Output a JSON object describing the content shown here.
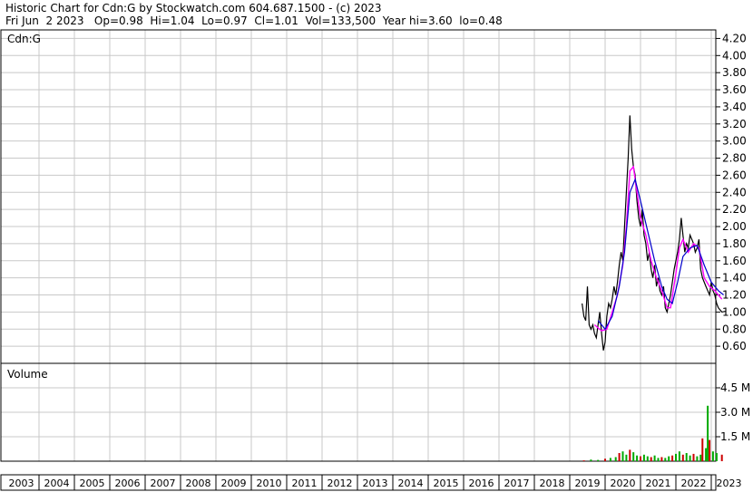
{
  "header": {
    "line1": "Historic Chart for Cdn:G by Stockwatch.com 604.687.1500 - (c) 2023",
    "line2": "Fri Jun  2 2023   Op=0.98  Hi=1.04  Lo=0.97  Cl=1.01  Vol=133,500  Year hi=3.60  lo=0.48"
  },
  "colors": {
    "grid": "#c8c8c8",
    "price": "#000000",
    "ma_short": "#ff00ff",
    "ma_long": "#0000cc",
    "vol_up": "#00aa00",
    "vol_down": "#cc0000"
  },
  "chart_data": [
    {
      "type": "line",
      "title": "Cdn:G",
      "x_axis": "year",
      "ylim": [
        0.4,
        4.3
      ],
      "y_ticks": [
        "4.20",
        "4.00",
        "3.80",
        "3.60",
        "3.40",
        "3.20",
        "3.00",
        "2.80",
        "2.60",
        "2.40",
        "2.20",
        "2.00",
        "1.80",
        "1.60",
        "1.40",
        "1.20",
        "1.00",
        "0.80",
        "0.60"
      ],
      "grid": true,
      "series": [
        {
          "style": "price-bars",
          "points": [
            [
              2019.35,
              1.1
            ],
            [
              2019.4,
              0.95
            ],
            [
              2019.45,
              0.9
            ],
            [
              2019.5,
              1.3
            ],
            [
              2019.55,
              0.85
            ],
            [
              2019.6,
              0.8
            ],
            [
              2019.65,
              0.85
            ],
            [
              2019.7,
              0.75
            ],
            [
              2019.75,
              0.7
            ],
            [
              2019.8,
              0.85
            ],
            [
              2019.85,
              1.0
            ],
            [
              2019.9,
              0.75
            ],
            [
              2019.95,
              0.55
            ],
            [
              2020.0,
              0.65
            ],
            [
              2020.05,
              0.95
            ],
            [
              2020.1,
              1.1
            ],
            [
              2020.15,
              1.05
            ],
            [
              2020.2,
              1.15
            ],
            [
              2020.25,
              1.3
            ],
            [
              2020.3,
              1.2
            ],
            [
              2020.35,
              1.35
            ],
            [
              2020.4,
              1.55
            ],
            [
              2020.45,
              1.7
            ],
            [
              2020.5,
              1.6
            ],
            [
              2020.55,
              2.0
            ],
            [
              2020.6,
              2.4
            ],
            [
              2020.65,
              2.8
            ],
            [
              2020.7,
              3.3
            ],
            [
              2020.75,
              2.9
            ],
            [
              2020.8,
              2.7
            ],
            [
              2020.85,
              2.6
            ],
            [
              2020.9,
              2.3
            ],
            [
              2020.95,
              2.1
            ],
            [
              2021.0,
              2.0
            ],
            [
              2021.05,
              2.2
            ],
            [
              2021.1,
              1.9
            ],
            [
              2021.15,
              1.8
            ],
            [
              2021.2,
              1.6
            ],
            [
              2021.25,
              1.7
            ],
            [
              2021.3,
              1.5
            ],
            [
              2021.35,
              1.4
            ],
            [
              2021.4,
              1.55
            ],
            [
              2021.45,
              1.3
            ],
            [
              2021.5,
              1.4
            ],
            [
              2021.55,
              1.25
            ],
            [
              2021.6,
              1.2
            ],
            [
              2021.65,
              1.3
            ],
            [
              2021.7,
              1.05
            ],
            [
              2021.75,
              1.0
            ],
            [
              2021.8,
              1.1
            ],
            [
              2021.85,
              1.2
            ],
            [
              2021.9,
              1.35
            ],
            [
              2021.95,
              1.5
            ],
            [
              2022.0,
              1.6
            ],
            [
              2022.05,
              1.7
            ],
            [
              2022.1,
              1.85
            ],
            [
              2022.15,
              2.1
            ],
            [
              2022.2,
              1.9
            ],
            [
              2022.25,
              1.7
            ],
            [
              2022.3,
              1.8
            ],
            [
              2022.35,
              1.75
            ],
            [
              2022.4,
              1.9
            ],
            [
              2022.45,
              1.85
            ],
            [
              2022.5,
              1.8
            ],
            [
              2022.55,
              1.7
            ],
            [
              2022.6,
              1.75
            ],
            [
              2022.65,
              1.85
            ],
            [
              2022.7,
              1.5
            ],
            [
              2022.75,
              1.4
            ],
            [
              2022.8,
              1.35
            ],
            [
              2022.85,
              1.3
            ],
            [
              2022.9,
              1.25
            ],
            [
              2022.95,
              1.2
            ],
            [
              2023.0,
              1.35
            ],
            [
              2023.05,
              1.25
            ],
            [
              2023.1,
              1.2
            ],
            [
              2023.15,
              1.1
            ],
            [
              2023.2,
              1.05
            ],
            [
              2023.3,
              1.0
            ],
            [
              2023.42,
              1.01
            ]
          ]
        },
        {
          "style": "moving-average-short",
          "points": [
            [
              2019.7,
              0.85
            ],
            [
              2019.9,
              0.78
            ],
            [
              2020.05,
              0.8
            ],
            [
              2020.2,
              1.0
            ],
            [
              2020.35,
              1.2
            ],
            [
              2020.5,
              1.55
            ],
            [
              2020.6,
              2.0
            ],
            [
              2020.7,
              2.65
            ],
            [
              2020.8,
              2.7
            ],
            [
              2020.9,
              2.4
            ],
            [
              2021.0,
              2.1
            ],
            [
              2021.15,
              1.9
            ],
            [
              2021.3,
              1.6
            ],
            [
              2021.45,
              1.4
            ],
            [
              2021.6,
              1.25
            ],
            [
              2021.75,
              1.05
            ],
            [
              2021.85,
              1.05
            ],
            [
              2022.0,
              1.45
            ],
            [
              2022.1,
              1.75
            ],
            [
              2022.2,
              1.85
            ],
            [
              2022.35,
              1.7
            ],
            [
              2022.5,
              1.8
            ],
            [
              2022.65,
              1.75
            ],
            [
              2022.8,
              1.4
            ],
            [
              2022.95,
              1.3
            ],
            [
              2023.1,
              1.25
            ],
            [
              2023.3,
              1.15
            ]
          ]
        },
        {
          "style": "moving-average-long",
          "points": [
            [
              2019.8,
              0.9
            ],
            [
              2020.0,
              0.8
            ],
            [
              2020.2,
              0.95
            ],
            [
              2020.4,
              1.3
            ],
            [
              2020.55,
              1.7
            ],
            [
              2020.7,
              2.4
            ],
            [
              2020.85,
              2.55
            ],
            [
              2021.0,
              2.3
            ],
            [
              2021.2,
              1.95
            ],
            [
              2021.4,
              1.6
            ],
            [
              2021.6,
              1.3
            ],
            [
              2021.75,
              1.15
            ],
            [
              2021.9,
              1.1
            ],
            [
              2022.05,
              1.35
            ],
            [
              2022.2,
              1.65
            ],
            [
              2022.4,
              1.75
            ],
            [
              2022.6,
              1.78
            ],
            [
              2022.8,
              1.55
            ],
            [
              2023.0,
              1.35
            ],
            [
              2023.2,
              1.25
            ],
            [
              2023.35,
              1.2
            ]
          ]
        }
      ]
    },
    {
      "type": "bar",
      "title": "Volume",
      "ylim": [
        0,
        6.0
      ],
      "y_ticks": [
        "4.5 M",
        "3.0 M",
        "1.5 M"
      ],
      "grid": true,
      "categories_note": "years",
      "points": [
        [
          2019.4,
          0.05
        ],
        [
          2019.6,
          0.1
        ],
        [
          2019.8,
          0.08
        ],
        [
          2020.0,
          0.15
        ],
        [
          2020.15,
          0.2
        ],
        [
          2020.3,
          0.25
        ],
        [
          2020.4,
          0.5
        ],
        [
          2020.5,
          0.6
        ],
        [
          2020.6,
          0.4
        ],
        [
          2020.7,
          0.7
        ],
        [
          2020.8,
          0.55
        ],
        [
          2020.9,
          0.35
        ],
        [
          2021.0,
          0.3
        ],
        [
          2021.1,
          0.4
        ],
        [
          2021.2,
          0.3
        ],
        [
          2021.3,
          0.25
        ],
        [
          2021.4,
          0.35
        ],
        [
          2021.5,
          0.2
        ],
        [
          2021.6,
          0.25
        ],
        [
          2021.7,
          0.2
        ],
        [
          2021.8,
          0.3
        ],
        [
          2021.9,
          0.35
        ],
        [
          2022.0,
          0.45
        ],
        [
          2022.1,
          0.6
        ],
        [
          2022.2,
          0.4
        ],
        [
          2022.3,
          0.5
        ],
        [
          2022.4,
          0.35
        ],
        [
          2022.5,
          0.45
        ],
        [
          2022.6,
          0.3
        ],
        [
          2022.7,
          0.4
        ],
        [
          2022.75,
          1.4
        ],
        [
          2022.85,
          0.8
        ],
        [
          2022.9,
          3.4
        ],
        [
          2022.95,
          1.3
        ],
        [
          2023.05,
          0.6
        ],
        [
          2023.15,
          0.5
        ],
        [
          2023.3,
          0.4
        ]
      ]
    }
  ],
  "x_axis": {
    "labels": [
      "2003",
      "2004",
      "2005",
      "2006",
      "2007",
      "2008",
      "2009",
      "2010",
      "2011",
      "2012",
      "2013",
      "2014",
      "2015",
      "2016",
      "2017",
      "2018",
      "2019",
      "2020",
      "2021",
      "2022",
      "2023"
    ]
  }
}
